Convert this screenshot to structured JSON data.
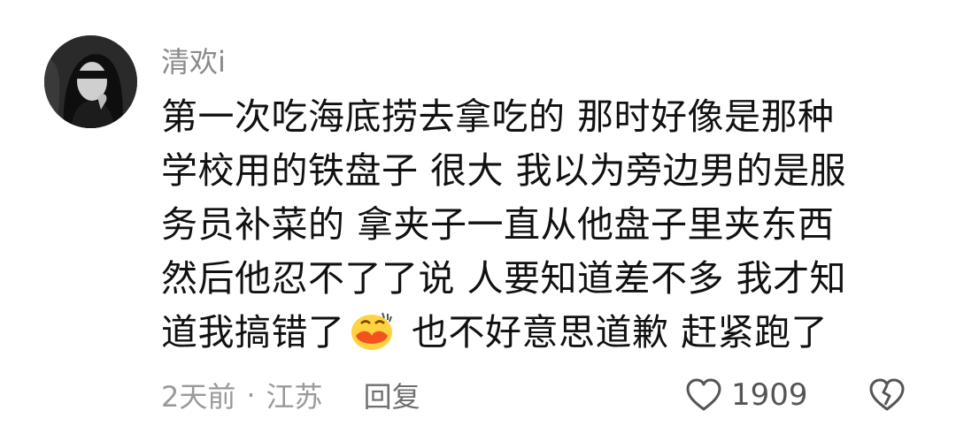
{
  "comment": {
    "username": "清欢i",
    "text_lines": [
      "第一次吃海底捞去拿吃的 那时好像是那种",
      "学校用的铁盘子 很大 我以为旁边男的是服",
      "务员补菜的 拿夹子一直从他盘子里夹东西",
      "然后他忍不了了说 人要知道差不多 我才知",
      "道我搞错了",
      " 也不好意思道歉 赶紧跑了"
    ],
    "emoji": "sweating-laughing-face-icon",
    "time": "2天前",
    "separator": "·",
    "location": "江苏",
    "reply_label": "回复",
    "like_count": "1909"
  },
  "colors": {
    "username": "#8a8a8a",
    "text": "#111111",
    "meta": "#9a9a9a",
    "emoji_face": "#ffd23f",
    "emoji_mouth": "#f4511e"
  }
}
